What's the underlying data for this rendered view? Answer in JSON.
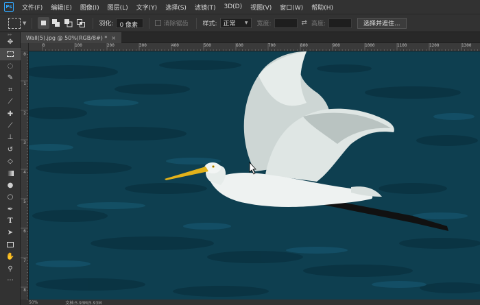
{
  "app": {
    "logo": "Ps"
  },
  "menu": [
    "文件(F)",
    "编辑(E)",
    "图像(I)",
    "图层(L)",
    "文字(Y)",
    "选择(S)",
    "滤镜(T)",
    "3D(D)",
    "视图(V)",
    "窗口(W)",
    "帮助(H)"
  ],
  "options": {
    "feather_label": "羽化:",
    "feather_value": "0 像素",
    "antialias_label": "消除锯齿",
    "style_label": "样式:",
    "style_value": "正常",
    "width_label": "宽度:",
    "height_label": "高度:",
    "select_mask_button": "选择并遮住..."
  },
  "tools": [
    "move-icon",
    "marquee-icon",
    "lasso-icon",
    "quick-select-icon",
    "crop-icon",
    "eyedropper-icon",
    "healing-brush-icon",
    "brush-icon",
    "clone-stamp-icon",
    "history-brush-icon",
    "eraser-icon",
    "gradient-icon",
    "blur-icon",
    "dodge-icon",
    "pen-icon",
    "type-icon",
    "path-select-icon",
    "rectangle-icon",
    "hand-icon",
    "zoom-icon",
    "more-icon"
  ],
  "document": {
    "tab_label": "Wall(5).jpg @ 50%(RGB/8#) *",
    "close": "×"
  },
  "ruler_top": [
    "0",
    "100",
    "200",
    "300",
    "400",
    "500",
    "600",
    "700",
    "800",
    "900",
    "1000",
    "1100",
    "1200",
    "1300"
  ],
  "ruler_left": [
    "0",
    "1",
    "2",
    "3",
    "4",
    "5",
    "6",
    "7",
    "8"
  ],
  "status": {
    "zoom": "50%",
    "doc": "文档:5.93M/5.93M"
  },
  "colors": {
    "water": "#0d3d4d",
    "egret": "#e8eeec",
    "beak": "#e2b21a",
    "accent": "#31a8ff"
  }
}
